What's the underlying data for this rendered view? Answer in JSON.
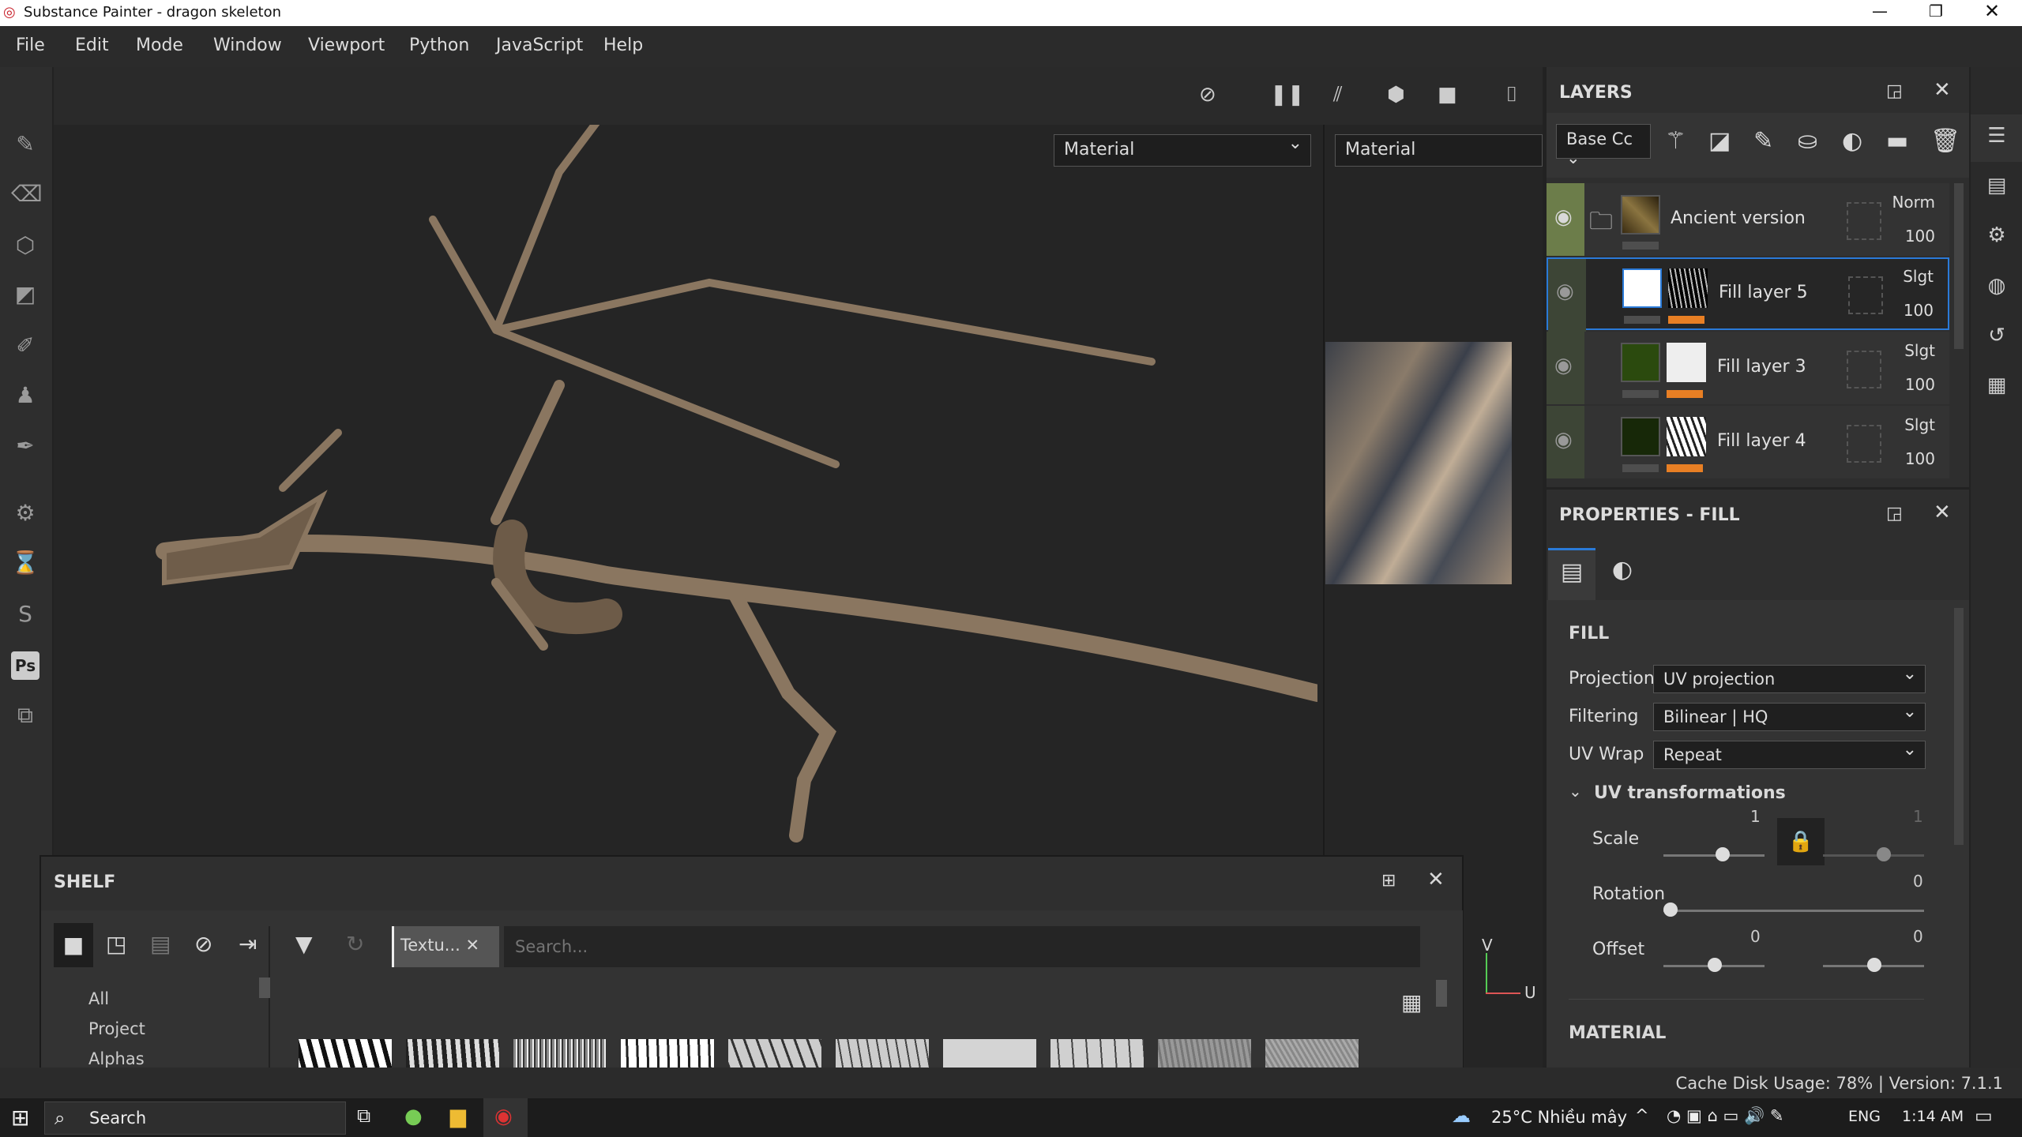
{
  "window": {
    "title": "Substance Painter - dragon skeleton"
  },
  "menu": [
    "File",
    "Edit",
    "Mode",
    "Window",
    "Viewport",
    "Python",
    "JavaScript",
    "Help"
  ],
  "viewport": {
    "material_left": "Material",
    "material_right": "Material",
    "axis_v": "V",
    "axis_u": "U"
  },
  "layers": {
    "title": "LAYERS",
    "channel": "Base Cc",
    "rows": [
      {
        "name": "Ancient version",
        "blend": "Norm",
        "opacity": "100",
        "type": "folder"
      },
      {
        "name": "Fill layer 5",
        "blend": "Slgt",
        "opacity": "100",
        "type": "fill",
        "selected": true
      },
      {
        "name": "Fill layer 3",
        "blend": "Slgt",
        "opacity": "100",
        "type": "fill"
      },
      {
        "name": "Fill layer 4",
        "blend": "Slgt",
        "opacity": "100",
        "type": "fill"
      }
    ]
  },
  "properties": {
    "title": "PROPERTIES - FILL",
    "section": "FILL",
    "projection_label": "Projection",
    "projection": "UV projection",
    "filtering_label": "Filtering",
    "filtering": "Bilinear | HQ",
    "uvwrap_label": "UV Wrap",
    "uvwrap": "Repeat",
    "uvt_label": "UV transformations",
    "scale_label": "Scale",
    "scale_u": "1",
    "scale_v": "1",
    "rotation_label": "Rotation",
    "rotation": "0",
    "offset_label": "Offset",
    "offset_u": "0",
    "offset_v": "0",
    "material_section": "MATERIAL"
  },
  "shelf": {
    "title": "SHELF",
    "filter_tag": "Textu...",
    "search_placeholder": "Search...",
    "categories": [
      "All",
      "Project",
      "Alphas"
    ]
  },
  "status": {
    "text": "Cache Disk Usage: 78% | Version: 7.1.1"
  },
  "taskbar": {
    "search": "Search",
    "weather": "25°C  Nhiều mây",
    "lang": "ENG",
    "time": "1:14 AM"
  }
}
